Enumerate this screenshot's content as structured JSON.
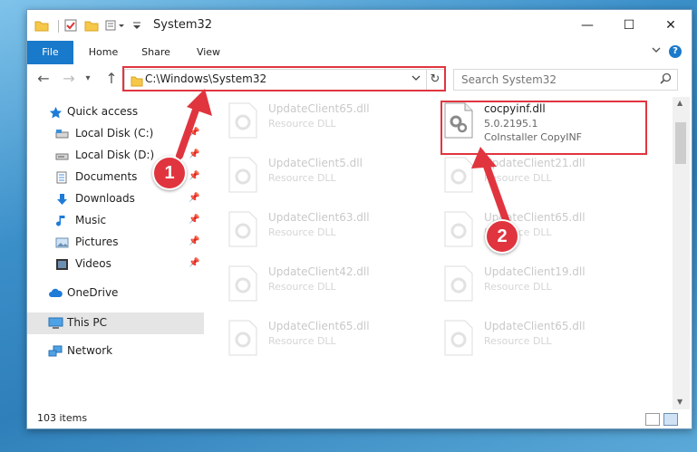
{
  "window": {
    "title": "System32",
    "controls": {
      "minimize": "—",
      "maximize": "☐",
      "close": "✕"
    }
  },
  "ribbon": {
    "tabs": [
      "File",
      "Home",
      "Share",
      "View"
    ],
    "expand_icon": "chevron-down-icon",
    "help": "?"
  },
  "address": {
    "path": "C:\\Windows\\System32",
    "refresh_icon": "refresh-icon"
  },
  "search": {
    "placeholder": "Search System32"
  },
  "nav": {
    "items": [
      {
        "label": "Quick access",
        "icon": "star-icon",
        "pinned": false
      },
      {
        "label": "Local Disk (C:)",
        "icon": "drive-icon",
        "pinned": true
      },
      {
        "label": "Local Disk (D:)",
        "icon": "drive-icon",
        "pinned": true
      },
      {
        "label": "Documents",
        "icon": "documents-icon",
        "pinned": true
      },
      {
        "label": "Downloads",
        "icon": "downloads-icon",
        "pinned": true
      },
      {
        "label": "Music",
        "icon": "music-icon",
        "pinned": true
      },
      {
        "label": "Pictures",
        "icon": "pictures-icon",
        "pinned": true
      },
      {
        "label": "Videos",
        "icon": "videos-icon",
        "pinned": true
      },
      {
        "label": "OneDrive",
        "icon": "cloud-icon",
        "pinned": false
      },
      {
        "label": "This PC",
        "icon": "computer-icon",
        "pinned": false,
        "selected": true
      },
      {
        "label": "Network",
        "icon": "network-icon",
        "pinned": false
      }
    ]
  },
  "files": {
    "left_column": [
      {
        "name": "UpdateClient65.dll",
        "desc": "Resource DLL"
      },
      {
        "name": "UpdateClient5.dll",
        "desc": "Resource DLL"
      },
      {
        "name": "UpdateClient63.dll",
        "desc": "Resource DLL"
      },
      {
        "name": "UpdateClient42.dll",
        "desc": "Resource DLL"
      },
      {
        "name": "UpdateClient65.dll",
        "desc": "Resource DLL"
      }
    ],
    "right_column": [
      {
        "name": "cocpyinf.dll",
        "desc": "5.0.2195.1",
        "sub": "CoInstaller CopyINF",
        "highlight": true
      },
      {
        "name": "UpdateClient21.dll",
        "desc": "Resource DLL"
      },
      {
        "name": "UpdateClient65.dll",
        "desc": "Resource DLL"
      },
      {
        "name": "UpdateClient19.dll",
        "desc": "Resource DLL"
      },
      {
        "name": "UpdateClient65.dll",
        "desc": "Resource DLL"
      }
    ]
  },
  "status": {
    "item_count": "103 items"
  },
  "annotations": {
    "callout_1": "1",
    "callout_2": "2",
    "color": "#e0353f"
  }
}
